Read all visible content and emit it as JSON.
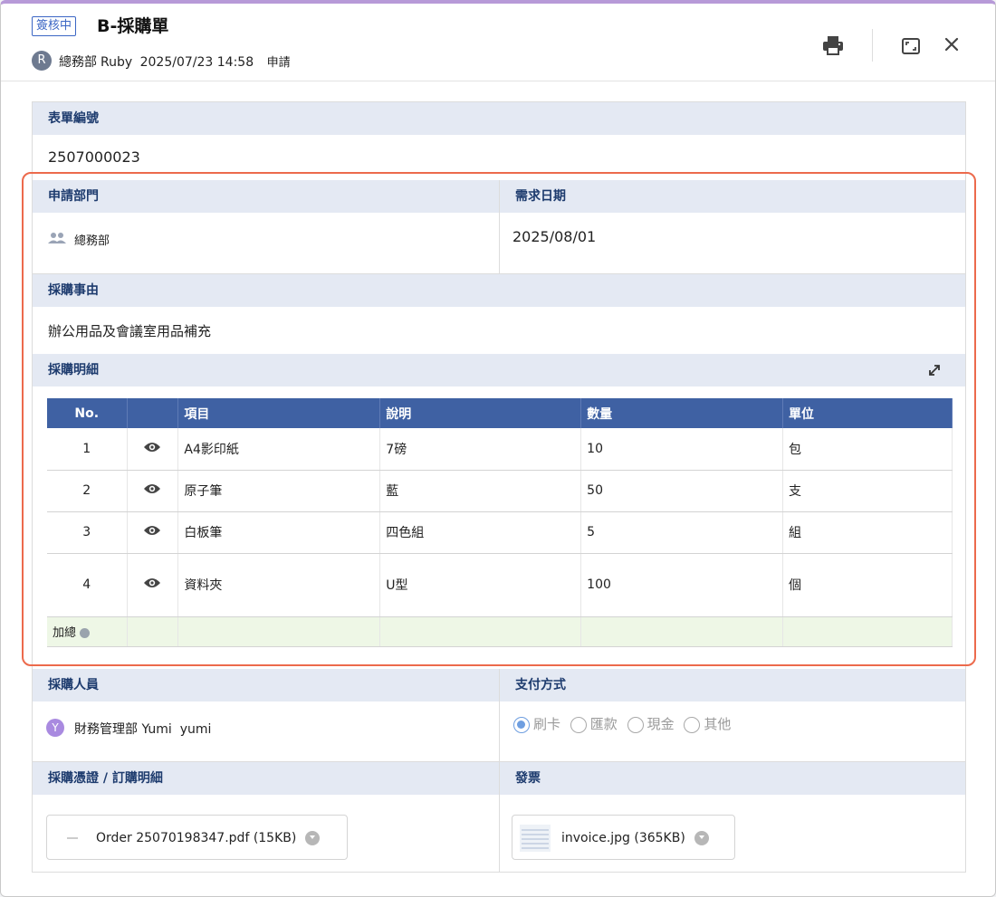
{
  "header": {
    "status": "簽核中",
    "title": "B-採購單",
    "avatar_letter": "R",
    "department": "總務部",
    "user": "Ruby",
    "datetime": "2025/07/23 14:58",
    "action": "申請"
  },
  "form": {
    "form_no_label": "表單編號",
    "form_no": "2507000023",
    "dept_label": "申請部門",
    "dept_value": "總務部",
    "date_label": "需求日期",
    "date_value": "2025/08/01",
    "reason_label": "採購事由",
    "reason_value": "辦公用品及會議室用品補充",
    "detail_label": "採購明細"
  },
  "items_table": {
    "columns": [
      "No.",
      "",
      "項目",
      "說明",
      "數量",
      "單位"
    ],
    "rows": [
      {
        "no": "1",
        "item": "A4影印紙",
        "desc": "7磅",
        "qty": "10",
        "unit": "包"
      },
      {
        "no": "2",
        "item": "原子筆",
        "desc": "藍",
        "qty": "50",
        "unit": "支"
      },
      {
        "no": "3",
        "item": "白板筆",
        "desc": "四色組",
        "qty": "5",
        "unit": "組"
      },
      {
        "no": "4",
        "item": "資料夾",
        "desc": "U型",
        "qty": "100",
        "unit": "個"
      }
    ],
    "total_label": "加總"
  },
  "purchaser": {
    "label": "採購人員",
    "avatar_letter": "Y",
    "value": "財務管理部 Yumi  yumi"
  },
  "payment": {
    "label": "支付方式",
    "options": [
      "刷卡",
      "匯款",
      "現金",
      "其他"
    ],
    "selected": "刷卡"
  },
  "attachments": {
    "voucher_label": "採購憑證 / 訂購明細",
    "voucher_file": "Order 25070198347.pdf (15KB)",
    "invoice_label": "發票",
    "invoice_file": "invoice.jpg (365KB)"
  },
  "colors": {
    "accent": "#3f61a3",
    "section_header_bg": "#e4e9f3",
    "highlight_border": "#ec6a4c",
    "top_border": "#b79ad8"
  },
  "icons": [
    "print-icon",
    "maximize-icon",
    "close-icon",
    "users-icon",
    "eye-icon",
    "expand-icon",
    "info-icon",
    "file-icon",
    "image-file-icon",
    "chevron-down-icon"
  ]
}
